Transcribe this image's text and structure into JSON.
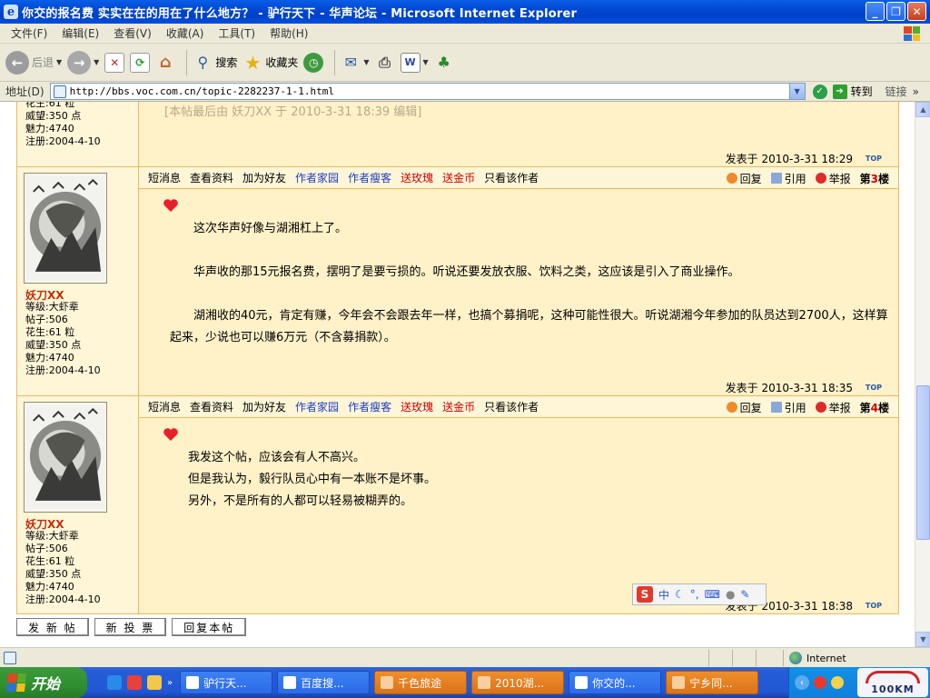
{
  "window": {
    "title": "你交的报名费 实实在在的用在了什么地方？ - 驴行天下 - 华声论坛 - Microsoft Internet Explorer"
  },
  "menu": [
    "文件(F)",
    "编辑(E)",
    "查看(V)",
    "收藏(A)",
    "工具(T)",
    "帮助(H)"
  ],
  "toolbar": {
    "back": "后退",
    "search": "搜索",
    "favorites": "收藏夹"
  },
  "address": {
    "label": "地址(D)",
    "url": "http://bbs.voc.com.cn/topic-2282237-1-1.html",
    "go": "转到",
    "links": "链接"
  },
  "colors": {
    "border": "#F0B85A",
    "post_bg": "#FFF1C8",
    "username": "#C42D0A",
    "link_blue": "#1A3EC8",
    "link_red": "#D40000"
  },
  "post_links": {
    "pm": "短消息",
    "profile": "查看资料",
    "add_friend": "加为好友",
    "author_home": "作者家园",
    "author_blog": "作者瘦客",
    "send_rose": "送玫瑰",
    "send_coin": "送金币",
    "only_author": "只看该作者",
    "reply": "回复",
    "quote": "引用",
    "report": "举报"
  },
  "prev_post": {
    "stats": [
      "花生:61 粒",
      "威望:350 点",
      "魅力:4740",
      "注册:2004-4-10"
    ],
    "edit_note": "[本帖最后由 妖刀XX 于 2010-3-31 18:39 编辑]",
    "posted": "发表于 2010-3-31 18:29"
  },
  "posts": [
    {
      "floor_prefix": "第",
      "floor_num": "3",
      "floor_suffix": "楼",
      "user": {
        "name": "妖刀XX",
        "stats": [
          "等级:大虾辈",
          "帖子:506",
          "花生:61 粒",
          "威望:350 点",
          "魅力:4740",
          "注册:2004-4-10"
        ]
      },
      "paragraphs": [
        "这次华声好像与湖湘杠上了。",
        "华声收的那15元报名费，摆明了是要亏损的。听说还要发放衣服、饮料之类，这应该是引入了商业操作。",
        "湖湘收的40元，肯定有赚，今年会不会跟去年一样，也搞个募捐呢，这种可能性很大。听说湖湘今年参加的队员达到2700人，这样算起来，少说也可以赚6万元（不含募捐款）。"
      ],
      "posted": "发表于 2010-3-31 18:35"
    },
    {
      "floor_prefix": "第",
      "floor_num": "4",
      "floor_suffix": "楼",
      "user": {
        "name": "妖刀XX",
        "stats": [
          "等级:大虾辈",
          "帖子:506",
          "花生:61 粒",
          "威望:350 点",
          "魅力:4740",
          "注册:2004-4-10"
        ]
      },
      "lines": [
        "我发这个帖，应该会有人不高兴。",
        "但是我认为，毅行队员心中有一本账不是坏事。",
        "另外，不是所有的人都可以轻易被糊弄的。"
      ],
      "posted": "发表于 2010-3-31 18:38"
    }
  ],
  "top_label": "TOP",
  "bottom_buttons": [
    "发 新 帖",
    "新 投 票",
    "回复本帖"
  ],
  "ime": {
    "mode": "中"
  },
  "status": {
    "zone": "Internet"
  },
  "taskbar": {
    "start": "开始",
    "tasks": [
      {
        "label": "驴行天...",
        "style": "blue"
      },
      {
        "label": "百度搜...",
        "style": "blue"
      },
      {
        "label": "千色旅途",
        "style": "orange"
      },
      {
        "label": "2010湖...",
        "style": "orange"
      },
      {
        "label": "你交的...",
        "style": "blue"
      },
      {
        "label": "宁乡同...",
        "style": "orange"
      }
    ],
    "tray_logo": "100KM"
  }
}
